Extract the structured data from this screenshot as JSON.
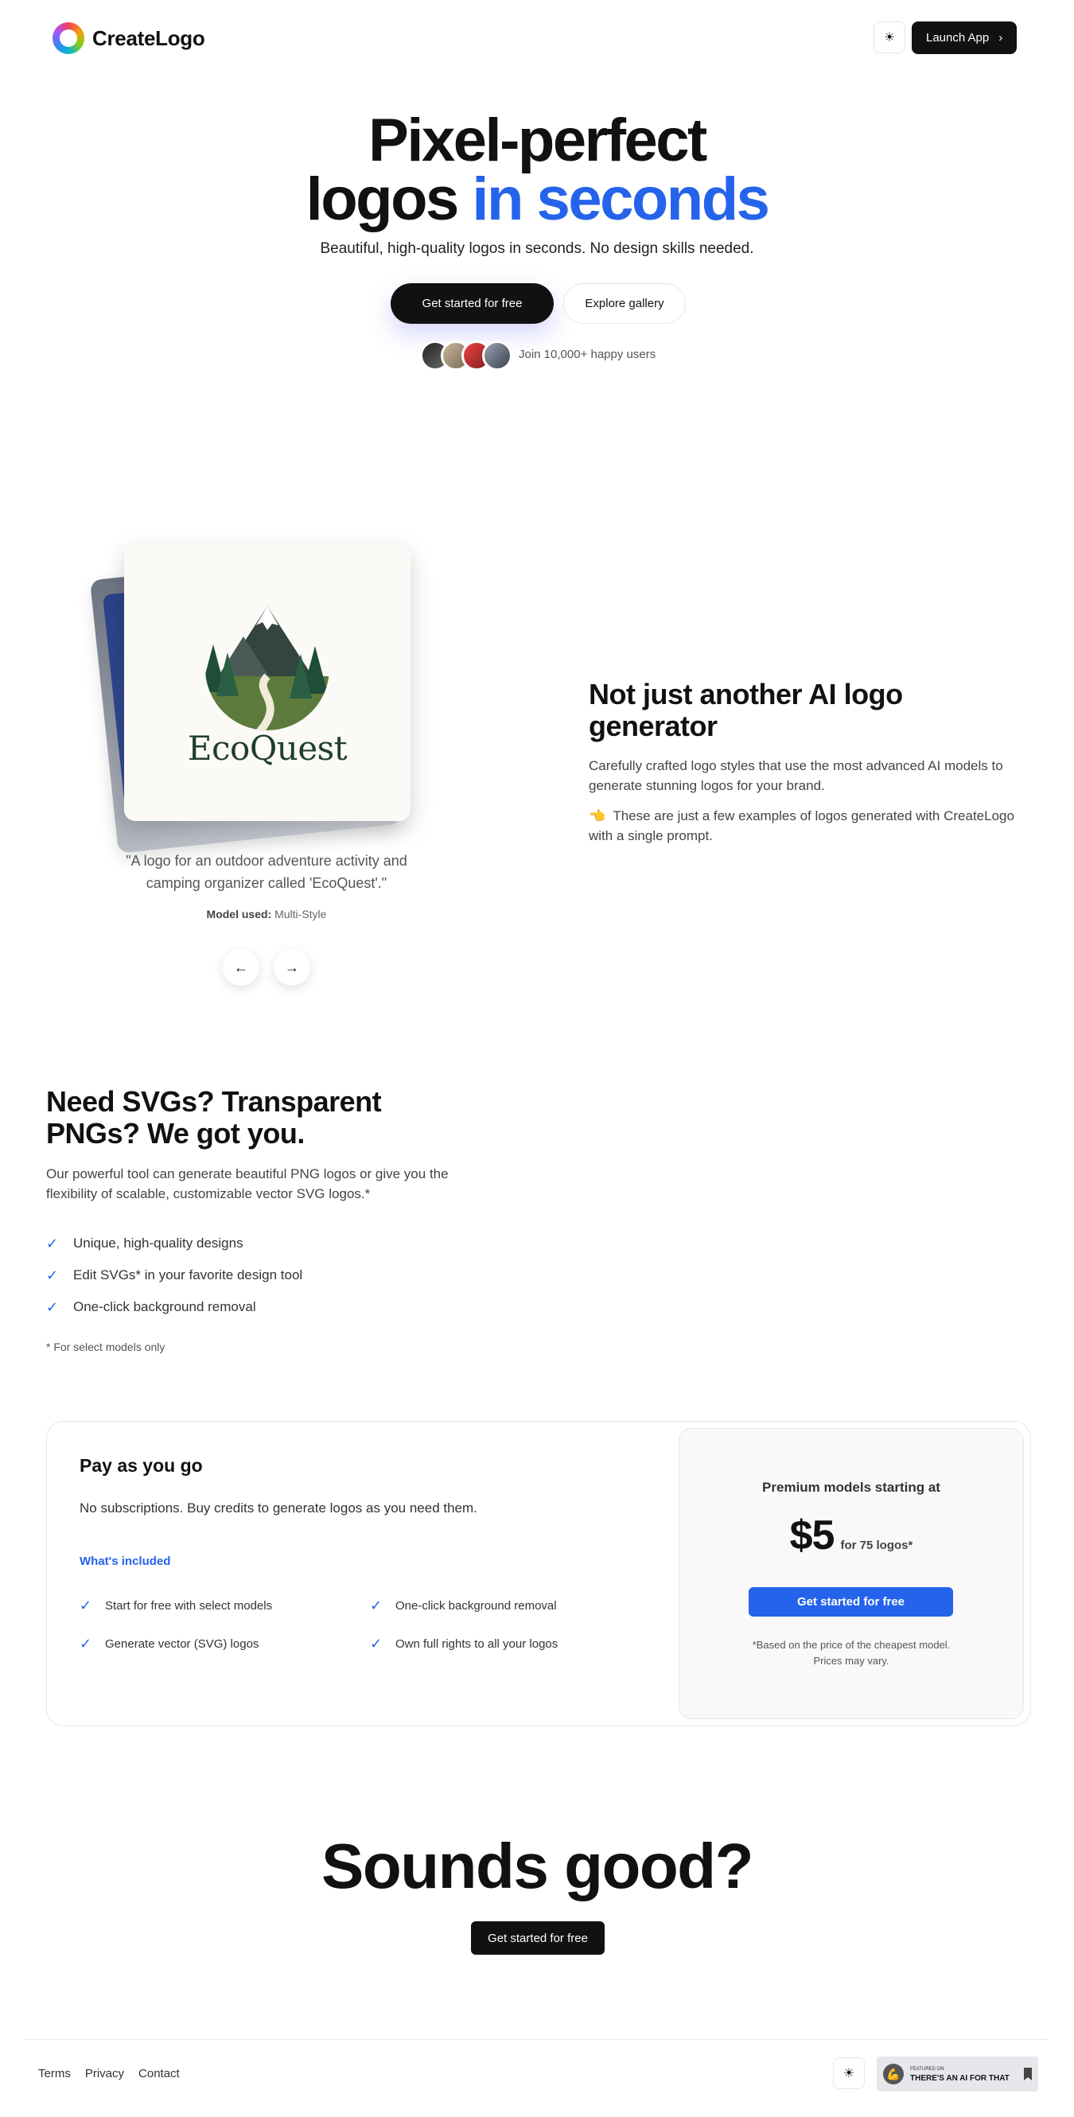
{
  "header": {
    "brand_name": "CreateLogo",
    "theme_icon": "sun-icon",
    "launch_label": "Launch App",
    "launch_icon": "chevron-right-icon"
  },
  "hero": {
    "title_line1": "Pixel-perfect",
    "title_line2_plain": "logos",
    "title_line2_accent": "in seconds",
    "accent_color": "#2563eb",
    "subtitle": "Beautiful, high-quality logos in seconds. No design skills needed.",
    "cta_primary": "Get started for free",
    "cta_secondary": "Explore gallery",
    "join_text": "Join 10,000+ happy users"
  },
  "showcase": {
    "logo_word": "EcoQuest",
    "quote": "\"A logo for an outdoor adventure activity and camping organizer called 'EcoQuest'.\"",
    "model_label": "Model used:",
    "model_value": "Multi-Style",
    "prev_icon": "arrow-left-icon",
    "next_icon": "arrow-right-icon"
  },
  "not_just": {
    "title": "Not just another AI logo generator",
    "p1": "Carefully crafted logo styles that use the most advanced AI models to generate stunning logos for your brand.",
    "p2_emoji": "👈",
    "p2": "These are just a few examples of logos generated with CreateLogo with a single prompt."
  },
  "svg_section": {
    "title": "Need SVGs? Transparent PNGs? We got you.",
    "text": "Our powerful tool can generate beautiful PNG logos or give you the flexibility of scalable, customizable vector SVG logos.*",
    "features": [
      "Unique, high-quality designs",
      "Edit SVGs* in your favorite design tool",
      "One-click background removal"
    ],
    "footnote": "* For select models only"
  },
  "pricing": {
    "title": "Pay as you go",
    "description": "No subscriptions. Buy credits to generate logos as you need them.",
    "included_label": "What's included",
    "included": [
      "Start for free with select models",
      "One-click background removal",
      "Generate vector (SVG) logos",
      "Own full rights to all your logos"
    ],
    "premium_label": "Premium models starting at",
    "price": "$5",
    "price_unit": "for 75 logos*",
    "button": "Get started for free",
    "note": "*Based on the price of the cheapest model. Prices may vary.",
    "button_color": "#2563eb"
  },
  "bottom_cta": {
    "title": "Sounds good?",
    "button": "Get started for free"
  },
  "footer": {
    "links": [
      "Terms",
      "Privacy",
      "Contact"
    ],
    "badge_small": "FEATURED ON",
    "badge_big": "THERE'S AN AI FOR THAT"
  }
}
